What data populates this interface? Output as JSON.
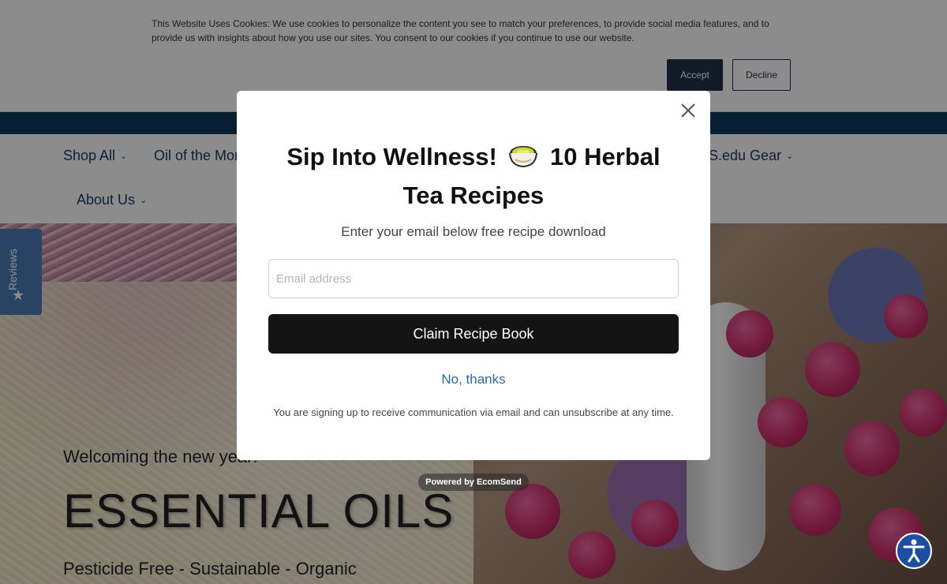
{
  "cookie_banner": {
    "text": "This Website Uses Cookies: We use cookies to personalize the content you see to match your preferences, to provide social media features, and to provide us with insights about how you use our sites. You consent to our cookies if you continue to use our website.",
    "accept_label": "Accept",
    "decline_label": "Decline"
  },
  "nav": {
    "items": [
      {
        "label": "Shop All"
      },
      {
        "label": "Oil of the Mon"
      },
      {
        "label": "S.edu Gear"
      },
      {
        "label": "About Us"
      }
    ]
  },
  "reviews_tab": {
    "label": "Reviews"
  },
  "hero": {
    "subtitle": "Welcoming the new year!",
    "title": "ESSENTIAL OILS",
    "tagline": "Pesticide Free - Sustainable - Organic"
  },
  "popup": {
    "title_part1": "Sip Into Wellness!",
    "title_part2": "10 Herbal Tea Recipes",
    "subtitle": "Enter your email below free recipe download",
    "email_placeholder": "Email address",
    "claim_label": "Claim Recipe Book",
    "decline_label": "No, thanks",
    "disclaimer": "You are signing up to receive communication via email and can unsubscribe at any time.",
    "powered_by": "Powered by EcomSend"
  },
  "icons": {
    "close": "close-icon",
    "tea": "tea-cup-icon",
    "star": "star-icon",
    "accessibility": "accessibility-icon",
    "chevron": "chevron-down-icon"
  },
  "colors": {
    "cookie_accept_bg": "#1f3147",
    "announce_bar": "#0b3a5c",
    "nav_text": "#1f3b60",
    "claim_button_bg": "#141414",
    "no_thanks_link": "#2a6aa0",
    "reviews_tab_bg": "#4a7ab5",
    "accessibility_bg": "#1d4fa0"
  }
}
